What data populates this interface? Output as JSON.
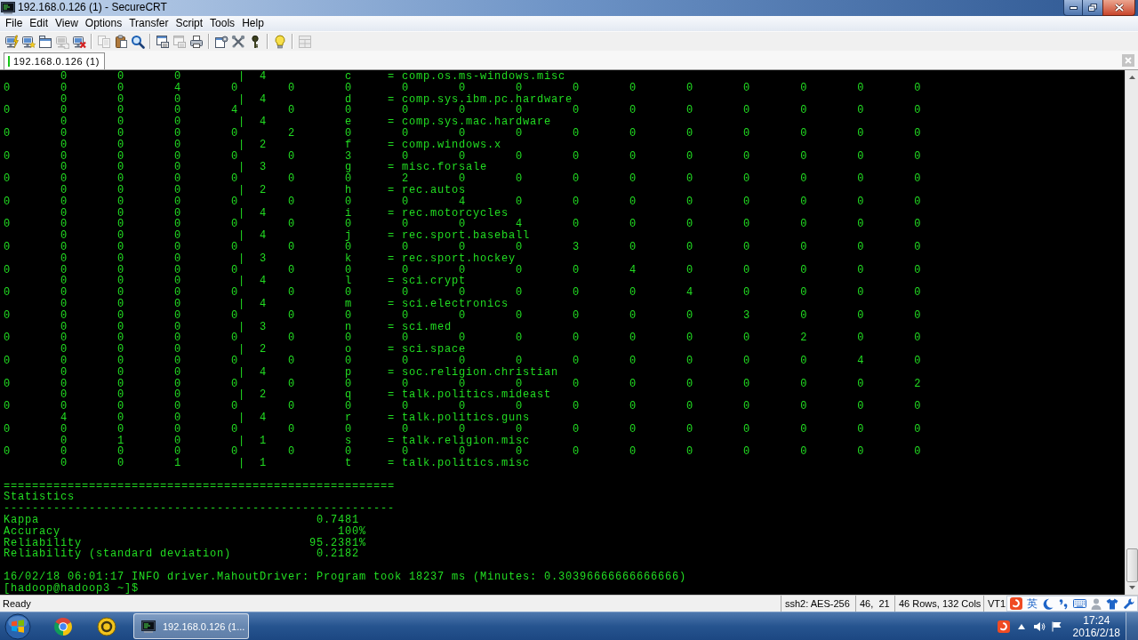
{
  "window": {
    "title": "192.168.0.126 (1) - SecureCRT"
  },
  "menu": [
    "File",
    "Edit",
    "View",
    "Options",
    "Transfer",
    "Script",
    "Tools",
    "Help"
  ],
  "toolbar": [
    [
      {
        "disabled": false
      },
      {
        "disabled": false
      },
      {
        "disabled": false
      },
      {
        "disabled": true
      },
      {
        "disabled": false
      }
    ],
    [
      {
        "disabled": true
      },
      {
        "disabled": false
      },
      {
        "disabled": false
      }
    ],
    [
      {
        "disabled": false
      },
      {
        "disabled": true
      },
      {
        "disabled": false
      }
    ],
    [
      {
        "disabled": false
      },
      {
        "disabled": false
      },
      {
        "disabled": false
      }
    ],
    [
      {
        "disabled": false
      }
    ],
    [
      {
        "disabled": true
      }
    ]
  ],
  "tabs": [
    {
      "label": "192.168.0.126 (1)",
      "selected": true,
      "connected": true
    }
  ],
  "terminal": {
    "blocks": [
      [
        "        0       0       0        |  4           c     = comp.os.ms-windows.misc",
        "0       0       0       4       0       0       0       0       0       0       0       0       0       0       0       0       0",
        "        0       0       0        |  4           d     = comp.sys.ibm.pc.hardware",
        "0       0       0       0       4       0       0       0       0       0       0       0       0       0       0       0       0",
        "        0       0       0        |  4           e     = comp.sys.mac.hardware",
        "0       0       0       0       0       2       0       0       0       0       0       0       0       0       0       0       0",
        "        0       0       0        |  2           f     = comp.windows.x",
        "0       0       0       0       0       0       3       0       0       0       0       0       0       0       0       0       0",
        "        0       0       0        |  3           g     = misc.forsale",
        "0       0       0       0       0       0       0       2       0       0       0       0       0       0       0       0       0",
        "        0       0       0        |  2           h     = rec.autos",
        "0       0       0       0       0       0       0       0       4       0       0       0       0       0       0       0       0",
        "        0       0       0        |  4           i     = rec.motorcycles",
        "0       0       0       0       0       0       0       0       0       4       0       0       0       0       0       0       0",
        "        0       0       0        |  4           j     = rec.sport.baseball",
        "0       0       0       0       0       0       0       0       0       0       3       0       0       0       0       0       0",
        "        0       0       0        |  3           k     = rec.sport.hockey",
        "0       0       0       0       0       0       0       0       0       0       0       4       0       0       0       0       0",
        "        0       0       0        |  4           l     = sci.crypt",
        "0       0       0       0       0       0       0       0       0       0       0       0       4       0       0       0       0",
        "        0       0       0        |  4           m     = sci.electronics",
        "0       0       0       0       0       0       0       0       0       0       0       0       0       3       0       0       0",
        "        0       0       0        |  3           n     = sci.med",
        "0       0       0       0       0       0       0       0       0       0       0       0       0       0       2       0       0",
        "        0       0       0        |  2           o     = sci.space",
        "0       0       0       0       0       0       0       0       0       0       0       0       0       0       0       4       0",
        "        0       0       0        |  4           p     = soc.religion.christian",
        "0       0       0       0       0       0       0       0       0       0       0       0       0       0       0       0       2",
        "        0       0       0        |  2           q     = talk.politics.mideast",
        "0       0       0       0       0       0       0       0       0       0       0       0       0       0       0       0       0",
        "        4       0       0        |  4           r     = talk.politics.guns",
        "0       0       0       0       0       0       0       0       0       0       0       0       0       0       0       0       0",
        "        0       1       0        |  1           s     = talk.religion.misc",
        "0       0       0       0       0       0       0       0       0       0       0       0       0       0       0       0       0",
        "        0       0       1        |  1           t     = talk.politics.misc"
      ],
      [
        "=======================================================",
        "Statistics",
        "-------------------------------------------------------",
        "Kappa                                       0.7481",
        "Accuracy                                       100%",
        "Reliability                                95.2381%",
        "Reliability (standard deviation)            0.2182"
      ],
      [
        "16/02/18 06:01:17 INFO driver.MahoutDriver: Program took 18237 ms (Minutes: 0.30396666666666666)",
        "[hadoop@hadoop3 ~]$"
      ]
    ]
  },
  "status_bar": {
    "message": "Ready",
    "panes": [
      "ssh2: AES-256",
      "46,  21",
      "46 Rows, 132 Cols",
      "VT1"
    ]
  },
  "ime_toolbar": {
    "mode": "英"
  },
  "taskbar": {
    "windows": [
      {
        "label": "192.168.0.126 (1...",
        "selected": true
      }
    ],
    "clock": {
      "time": "17:24",
      "date": "2016/2/18"
    }
  }
}
